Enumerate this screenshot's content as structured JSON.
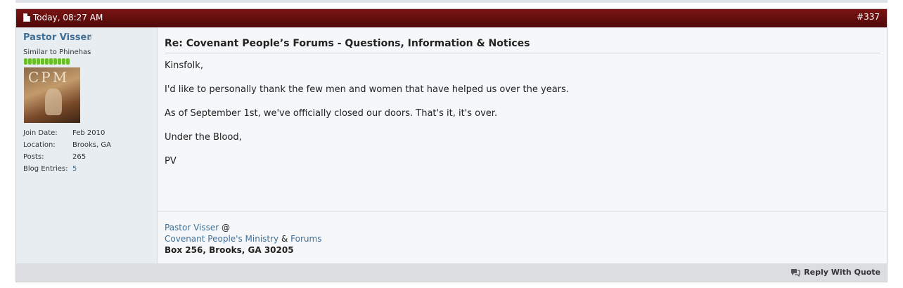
{
  "post": {
    "date": "Today, 08:27 AM",
    "number": "#337",
    "title": "Re: Covenant People’s Forums - Questions, Information & Notices",
    "body": [
      "Kinsfolk,",
      "I'd like to personally thank the few men and women that have helped us over the years.",
      "As of September 1st, we've officially closed our doors. That's it, it's over.",
      "Under the Blood,",
      "PV"
    ]
  },
  "user": {
    "name": "Pastor Visser",
    "title": "Similar to Phinehas",
    "avatar_text": "CPM",
    "details": [
      {
        "label": "Join Date:",
        "value": "Feb 2010"
      },
      {
        "label": "Location:",
        "value": "Brooks, GA"
      },
      {
        "label": "Posts:",
        "value": "265"
      },
      {
        "label": "Blog Entries:",
        "value": "5"
      }
    ]
  },
  "signature": {
    "name_link": "Pastor Visser",
    "at": "@",
    "ministry_link": "Covenant People's Ministry",
    "amp": "&",
    "forums_link": "Forums",
    "address": "Box 256, Brooks, GA 30205"
  },
  "footer": {
    "reply_label": "Reply With Quote",
    "icon": "reply-quote-icon"
  },
  "colors": {
    "header_bg": "#5c0c0c",
    "link": "#3f6f96",
    "reputation": "#6bbf2a"
  }
}
